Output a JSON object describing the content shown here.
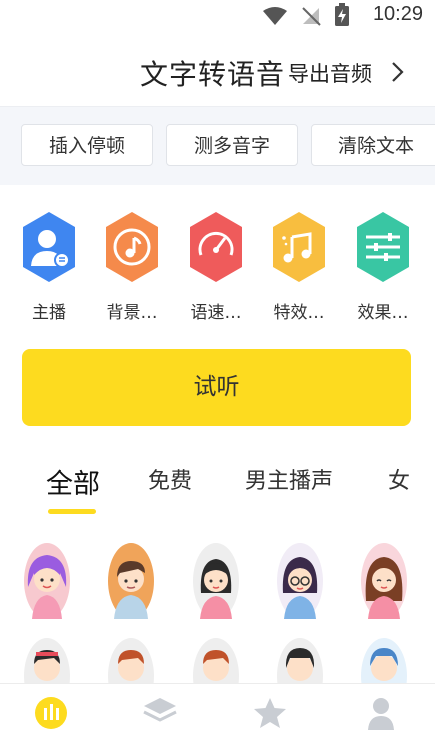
{
  "status_bar": {
    "time": "10:29"
  },
  "header": {
    "title": "文字转语音",
    "export_label": "导出音频"
  },
  "toolbar": {
    "buttons": [
      "插入停顿",
      "测多音字",
      "清除文本"
    ]
  },
  "features": [
    {
      "label": "主播",
      "icon": "anchor-person-icon",
      "color": "#3f86f0"
    },
    {
      "label": "背景…",
      "icon": "music-disc-icon",
      "color": "#f58a4b"
    },
    {
      "label": "语速…",
      "icon": "speedometer-icon",
      "color": "#ef5b5b"
    },
    {
      "label": "特效…",
      "icon": "music-note-icon",
      "color": "#f8be3f"
    },
    {
      "label": "效果…",
      "icon": "equalizer-sliders-icon",
      "color": "#39c6a3"
    }
  ],
  "listen_button": {
    "label": "试听",
    "color": "#fddb1f"
  },
  "tabs": [
    "全部",
    "免费",
    "男主播声",
    "女"
  ],
  "bottom_nav": [
    "audio-icon",
    "layers-icon",
    "star-icon",
    "profile-icon"
  ]
}
